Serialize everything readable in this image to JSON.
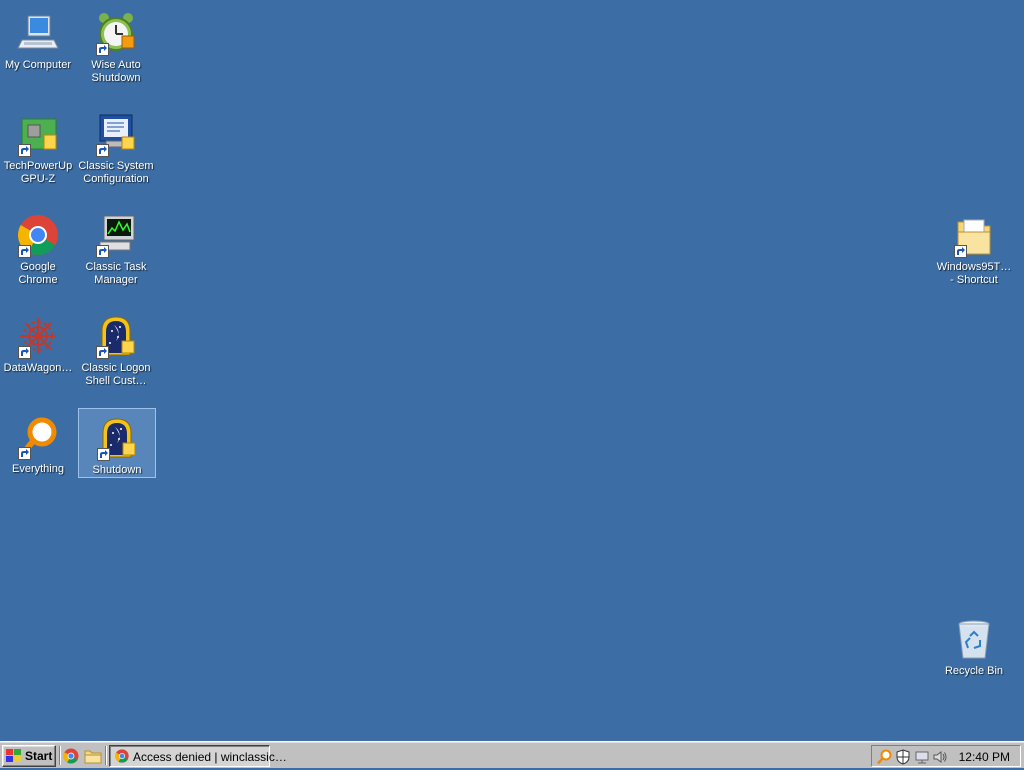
{
  "desktop": {
    "background_color": "#3c6ea5",
    "icons": [
      {
        "label": "My Computer",
        "icon": "computer-icon"
      },
      {
        "label": "Wise Auto\nShutdown",
        "icon": "alarm-clock-icon"
      },
      {
        "label": "TechPowerUp\nGPU-Z",
        "icon": "gpu-card-icon"
      },
      {
        "label": "Classic System\nConfiguration",
        "icon": "system-config-icon"
      },
      {
        "label": "Google Chrome",
        "icon": "chrome-icon"
      },
      {
        "label": "Classic Task\nManager",
        "icon": "task-manager-icon"
      },
      {
        "label": "DataWagon…",
        "icon": "gear-flower-icon"
      },
      {
        "label": "Classic Logon\nShell Cust…",
        "icon": "logon-shell-icon"
      },
      {
        "label": "Everything",
        "icon": "magnifier-icon"
      },
      {
        "label": "Shutdown",
        "icon": "logon-shell-icon"
      },
      {
        "label": "Windows95T…\n- Shortcut",
        "icon": "folder-icon"
      },
      {
        "label": "Recycle Bin",
        "icon": "recycle-bin-icon"
      }
    ],
    "selected_icon": "Shutdown"
  },
  "taskbar": {
    "start_label": "Start",
    "quick_launch": [
      "chrome-icon",
      "folder-icon"
    ],
    "tasks": [
      {
        "label": "Access denied | winclassic…",
        "icon": "chrome-icon"
      }
    ],
    "tray": {
      "icons": [
        "magnifier-icon",
        "shield-icon",
        "network-icon",
        "speaker-icon"
      ],
      "clock": "12:40 PM"
    }
  }
}
